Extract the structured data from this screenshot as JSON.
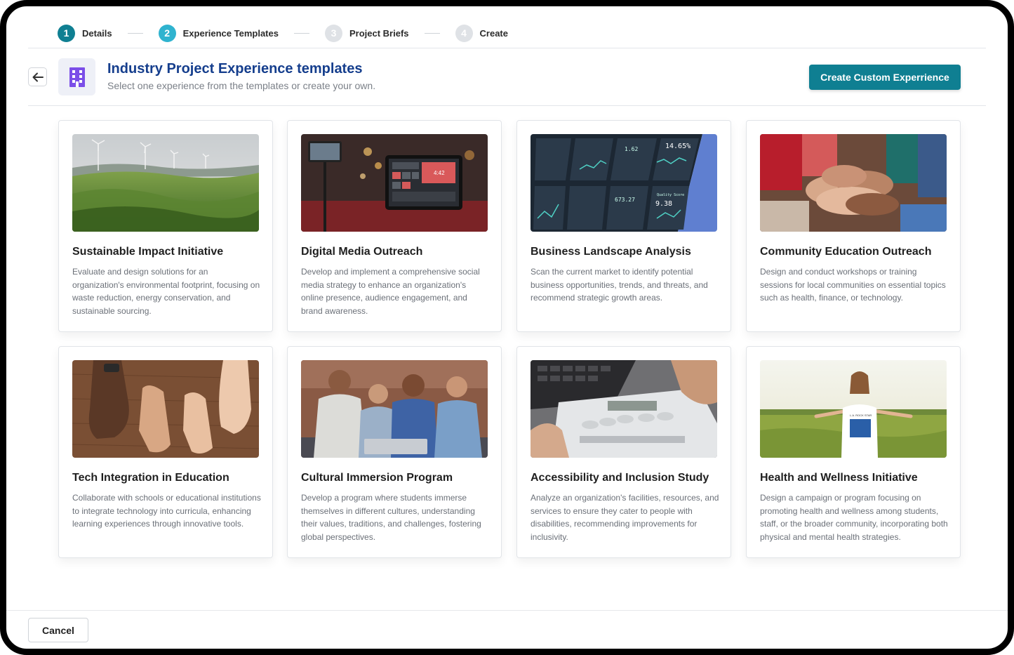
{
  "stepper": {
    "steps": [
      {
        "num": "1",
        "label": "Details"
      },
      {
        "num": "2",
        "label": "Experience Templates"
      },
      {
        "num": "3",
        "label": "Project Briefs"
      },
      {
        "num": "4",
        "label": "Create"
      }
    ]
  },
  "header": {
    "title": "Industry Project Experience templates",
    "subtitle": "Select one experience from the templates or create your own.",
    "create_button": "Create Custom Experrience"
  },
  "cards": [
    {
      "title": "Sustainable Impact Initiative",
      "description": "Evaluate and design solutions for an organization's environmental footprint, focusing on waste reduction, energy conservation, and sustainable sourcing."
    },
    {
      "title": "Digital Media Outreach",
      "description": "Develop and implement a comprehensive social media strategy to enhance an organization's online presence, audience engagement, and brand awareness."
    },
    {
      "title": "Business Landscape Analysis",
      "description": "Scan the current market to identify potential business opportunities, trends, and threats, and recommend strategic growth areas."
    },
    {
      "title": "Community Education Outreach",
      "description": "Design and conduct workshops or training sessions for local communities on essential topics such as health, finance, or technology."
    },
    {
      "title": "Tech Integration in Education",
      "description": "Collaborate with schools or educational institutions to integrate technology into curricula, enhancing learning experiences through innovative tools."
    },
    {
      "title": "Cultural Immersion Program",
      "description": "Develop a program where students immerse themselves in different cultures, understanding their values, traditions, and challenges, fostering global perspectives."
    },
    {
      "title": "Accessibility and Inclusion Study",
      "description": "Analyze an organization's facilities, resources, and services to ensure they cater to people with disabilities, recommending improvements for inclusivity."
    },
    {
      "title": "Health and Wellness Initiative",
      "description": "Design a campaign or program focusing on promoting health and wellness among students, staff, or the broader community, incorporating both physical and mental health strategies."
    }
  ],
  "dashboard_image_text": {
    "top_value": "14.65%",
    "small_a": "1.62",
    "small_b": "673.27",
    "quality_label": "Quality Score",
    "quality_value": "9.38"
  },
  "tablet_time": "4:42",
  "tshirt_text": "L.A. ROCK STAR",
  "footer": {
    "cancel": "Cancel"
  },
  "colors": {
    "primary": "#0f7f92",
    "step_active": "#2fb3cf",
    "title_blue": "#153e8d",
    "building_icon": "#7b4ee8"
  }
}
